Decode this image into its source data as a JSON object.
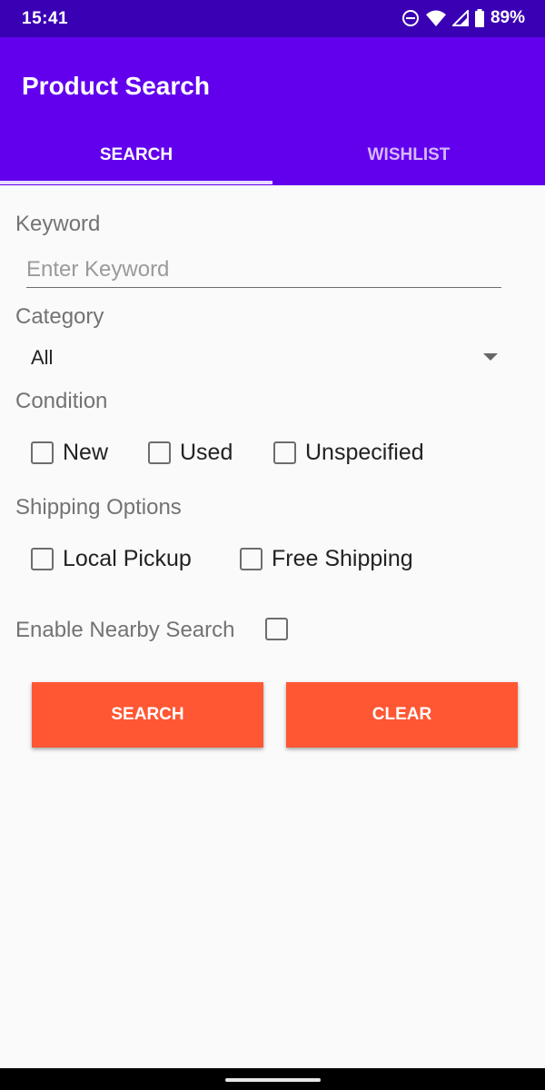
{
  "status_bar": {
    "time": "15:41",
    "battery": "89%"
  },
  "app": {
    "title": "Product Search"
  },
  "tabs": [
    {
      "label": "SEARCH"
    },
    {
      "label": "WISHLIST"
    }
  ],
  "form": {
    "keyword_label": "Keyword",
    "keyword_placeholder": "Enter Keyword",
    "category_label": "Category",
    "category_selected": "All",
    "condition_label": "Condition",
    "conditions": [
      {
        "label": "New"
      },
      {
        "label": "Used"
      },
      {
        "label": "Unspecified"
      }
    ],
    "shipping_label": "Shipping Options",
    "shipping": [
      {
        "label": "Local Pickup"
      },
      {
        "label": "Free Shipping"
      }
    ],
    "nearby_label": "Enable Nearby Search"
  },
  "buttons": {
    "search": "SEARCH",
    "clear": "CLEAR"
  },
  "colors": {
    "status_bar": "#3a00b4",
    "app_bar": "#6200ee",
    "button": "#ff5733"
  },
  "icons": [
    "do-not-disturb-icon",
    "wifi-icon",
    "cellular-signal-icon",
    "battery-icon",
    "dropdown-arrow-icon",
    "checkbox-icon"
  ]
}
